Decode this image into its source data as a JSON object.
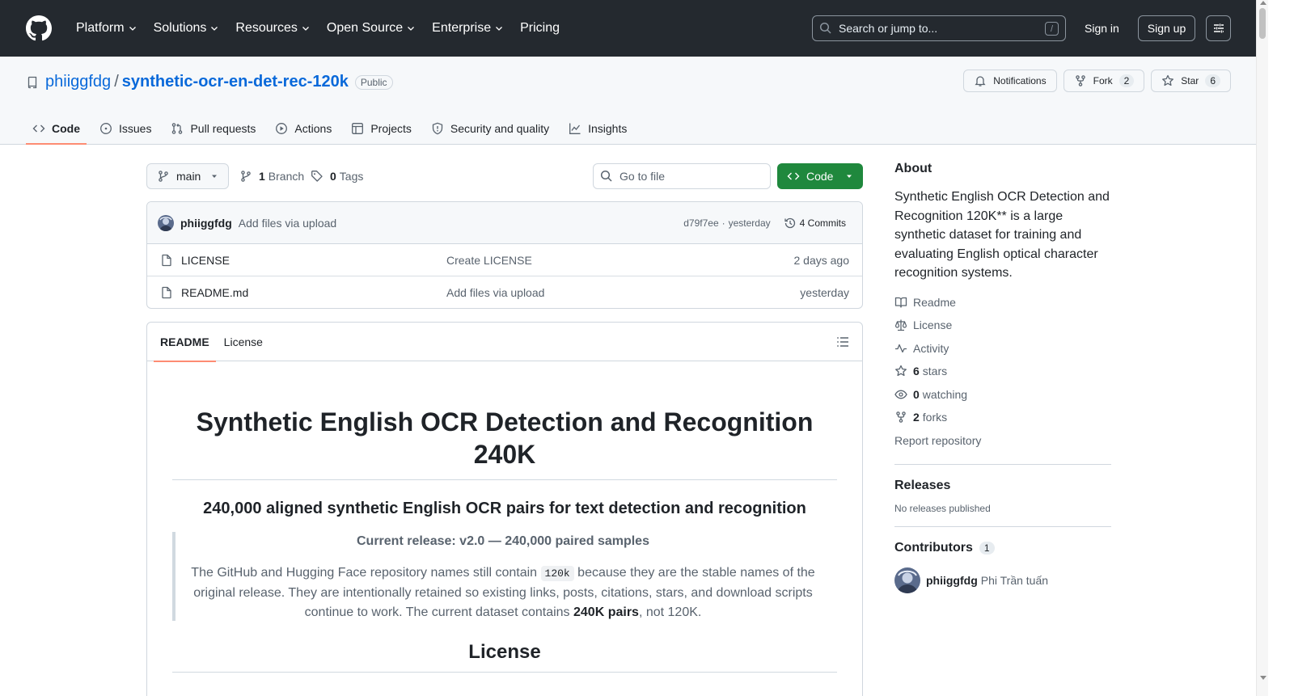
{
  "header": {
    "nav": [
      {
        "label": "Platform",
        "dropdown": true
      },
      {
        "label": "Solutions",
        "dropdown": true
      },
      {
        "label": "Resources",
        "dropdown": true
      },
      {
        "label": "Open Source",
        "dropdown": true
      },
      {
        "label": "Enterprise",
        "dropdown": true
      },
      {
        "label": "Pricing",
        "dropdown": false
      }
    ],
    "search_placeholder": "Search or jump to...",
    "search_shortcut": "/",
    "sign_in": "Sign in",
    "sign_up": "Sign up"
  },
  "repo": {
    "owner": "phiiggfdg",
    "separator": "/",
    "name": "synthetic-ocr-en-det-rec-120k",
    "visibility": "Public",
    "notifications_label": "Notifications",
    "fork_label": "Fork",
    "fork_count": "2",
    "star_label": "Star",
    "star_count": "6",
    "tabs": [
      {
        "label": "Code",
        "icon": "code-icon",
        "active": true
      },
      {
        "label": "Issues",
        "icon": "issue-icon",
        "active": false
      },
      {
        "label": "Pull requests",
        "icon": "pull-request-icon",
        "active": false
      },
      {
        "label": "Actions",
        "icon": "play-icon",
        "active": false
      },
      {
        "label": "Projects",
        "icon": "table-icon",
        "active": false
      },
      {
        "label": "Security and quality",
        "icon": "shield-icon",
        "active": false
      },
      {
        "label": "Insights",
        "icon": "graph-icon",
        "active": false
      }
    ]
  },
  "file_nav": {
    "branch": "main",
    "branch_count": "1",
    "branch_label": "Branch",
    "tag_count": "0",
    "tag_label": "Tags",
    "goto_placeholder": "Go to file",
    "code_button": "Code"
  },
  "latest_commit": {
    "author": "phiiggfdg",
    "message": "Add files via upload",
    "sha": "d79f7ee",
    "dot": "·",
    "time": "yesterday",
    "commits_label": "4 Commits"
  },
  "files": [
    {
      "name": "LICENSE",
      "message": "Create LICENSE",
      "age": "2 days ago"
    },
    {
      "name": "README.md",
      "message": "Add files via upload",
      "age": "yesterday"
    }
  ],
  "readme": {
    "tabs": [
      "README",
      "License"
    ],
    "h1": "Synthetic English OCR Detection and Recognition 240K",
    "h3": "240,000 aligned synthetic English OCR pairs for text detection and recognition",
    "quote_strong": "Current release: v2.0 — 240,000 paired samples",
    "quote_text_1": "The GitHub and Hugging Face repository names still contain ",
    "quote_code": "120k",
    "quote_text_2": " because they are the stable names of the original release. They are intentionally retained so existing links, posts, citations, stars, and download scripts continue to work. The current dataset contains ",
    "quote_bold": "240K pairs",
    "quote_text_3": ", not 120K.",
    "h2": "License"
  },
  "sidebar": {
    "about_title": "About",
    "about_desc": "Synthetic English OCR Detection and Recognition 120K** is a large synthetic dataset for training and evaluating English optical character recognition systems.",
    "readme_link": "Readme",
    "license_link": "License",
    "activity_link": "Activity",
    "stars_count": "6",
    "stars_label": "stars",
    "watching_count": "0",
    "watching_label": "watching",
    "forks_count": "2",
    "forks_label": "forks",
    "report": "Report repository",
    "releases_title": "Releases",
    "releases_empty": "No releases published",
    "contributors_title": "Contributors",
    "contributors_count": "1",
    "contributor_login": "phiiggfdg",
    "contributor_name": "Phi Trần tuấn"
  },
  "colors": {
    "header_bg": "#24292f",
    "link": "#0969da",
    "primary_button": "#1f883d",
    "active_tab_underline": "#fd8c73"
  }
}
